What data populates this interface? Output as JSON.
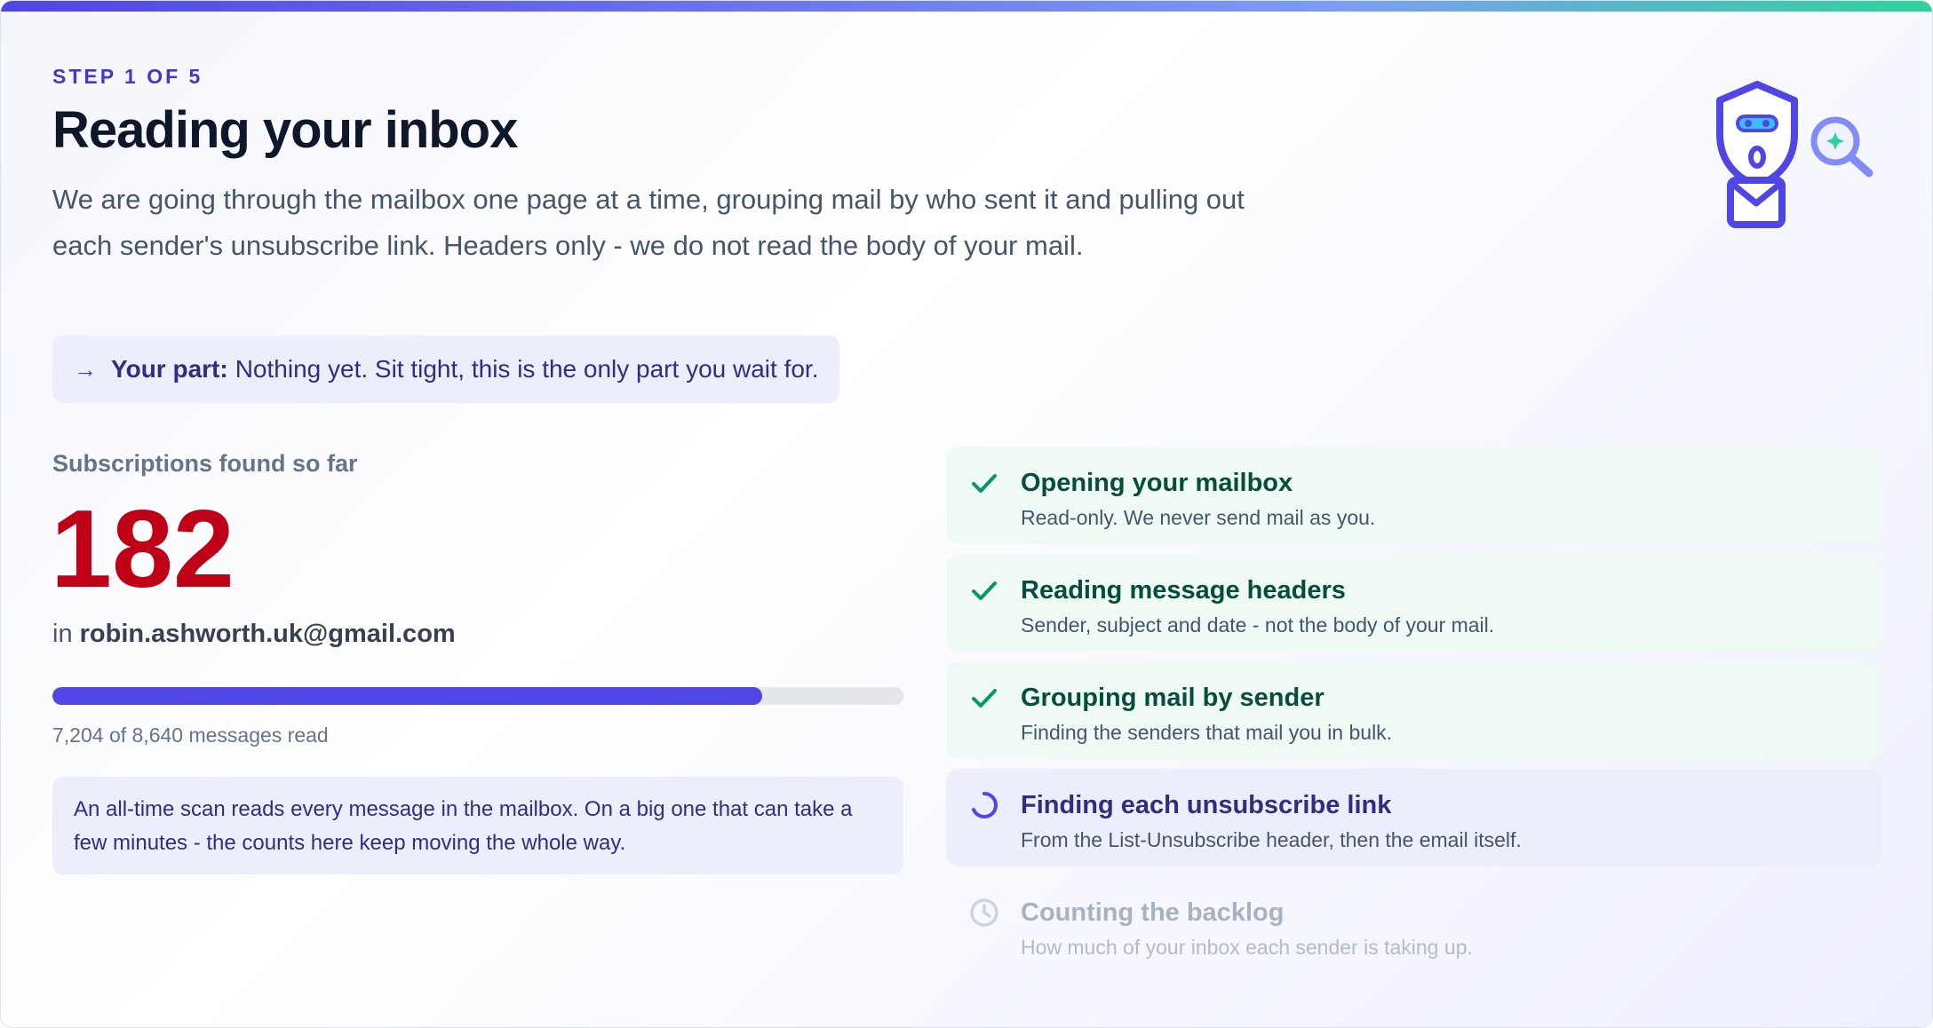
{
  "header": {
    "step_label": "STEP 1 OF 5",
    "title": "Reading your inbox",
    "intro": "We are going through the mailbox one page at a time, grouping mail by who sent it and pulling out each sender's unsubscribe link. Headers only - we do not read the body of your mail.",
    "your_part_arrow": "→",
    "your_part_label": "Your part:",
    "your_part_text": "Nothing yet. Sit tight, this is the only part you wait for."
  },
  "stats": {
    "found_label": "Subscriptions found so far",
    "count": "182",
    "in_prefix": "in",
    "email": "robin.ashworth.uk@gmail.com",
    "progress_text": "7,204 of 8,640 messages read",
    "messages_read": 7204,
    "messages_total": 8640,
    "note": "An all-time scan reads every message in the mailbox. On a big one that can take a few minutes - the counts here keep moving the whole way."
  },
  "steps": [
    {
      "state": "done",
      "icon": "check-icon",
      "title": "Opening your mailbox",
      "sub": "Read-only. We never send mail as you."
    },
    {
      "state": "done",
      "icon": "check-icon",
      "title": "Reading message headers",
      "sub": "Sender, subject and date - not the body of your mail."
    },
    {
      "state": "done",
      "icon": "check-icon",
      "title": "Grouping mail by sender",
      "sub": "Finding the senders that mail you in bulk."
    },
    {
      "state": "active",
      "icon": "spinner-icon",
      "title": "Finding each unsubscribe link",
      "sub": "From the List-Unsubscribe header, then the email itself."
    },
    {
      "state": "pending",
      "icon": "clock-icon",
      "title": "Counting the backlog",
      "sub": "How much of your inbox each sender is taking up."
    }
  ],
  "colors": {
    "accent": "#4f46e5",
    "count": "#c00016",
    "done": "#059669",
    "pending": "#cbd5e1"
  }
}
